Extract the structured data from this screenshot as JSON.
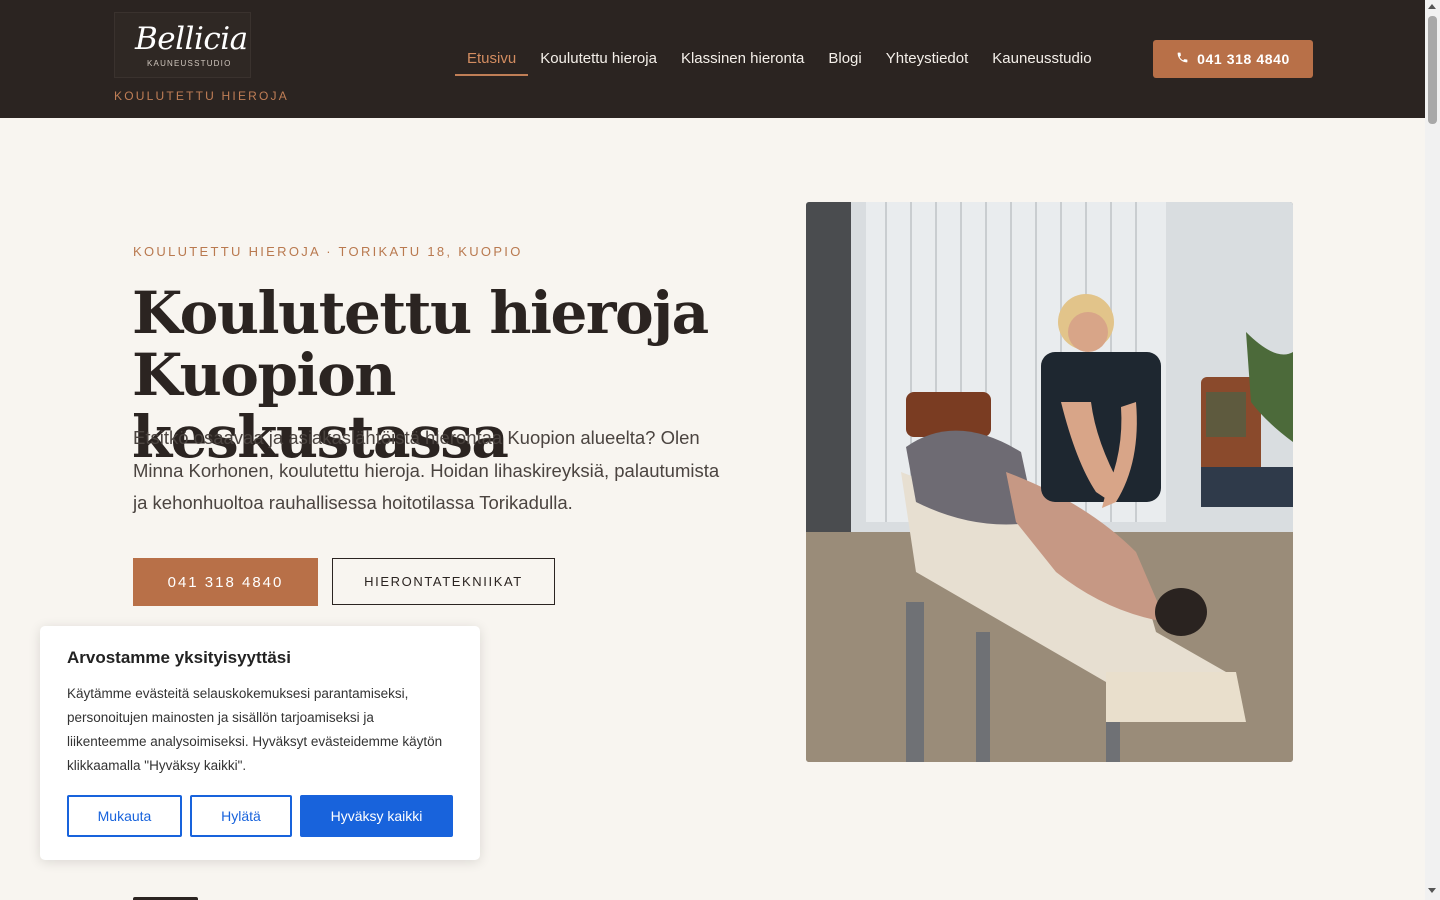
{
  "brand": {
    "logo_script": "Bellicia",
    "logo_sub": "KAUNEUSSTUDIO",
    "tagline": "KOULUTETTU HIEROJA"
  },
  "nav": {
    "items": [
      {
        "label": "Etusivu",
        "active": true
      },
      {
        "label": "Koulutettu hieroja"
      },
      {
        "label": "Klassinen hieronta"
      },
      {
        "label": "Blogi"
      },
      {
        "label": "Yhteystiedot"
      },
      {
        "label": "Kauneusstudio"
      }
    ],
    "phone_button": "041 318 4840",
    "phone_icon": "phone-icon"
  },
  "hero": {
    "eyebrow": "KOULUTETTU HIEROJA · TORIKATU 18, KUOPIO",
    "title_line1": "Koulutettu hieroja",
    "title_line2": "Kuopion keskustassa",
    "text": "Etsitkö osaavaa ja asiakaslähtöistä hierontaa Kuopion alueelta? Olen Minna Korhonen, koulutettu hieroja. Hoidan lihaskireyksiä, palautumista ja kehonhuoltoa rauhallisessa hoitotilassa Torikadulla.",
    "primary_button": "041 318 4840",
    "secondary_button": "HIERONTATEKNIIKAT"
  },
  "cookie": {
    "title": "Arvostamme yksityisyyttäsi",
    "text": "Käytämme evästeitä selauskokemuksesi parantamiseksi, personoitujen mainosten ja sisällön tarjoamiseksi ja liikenteemme analysoimiseksi. Hyväksyt evästeidemme käytön klikkaamalla \"Hyväksy kaikki\".",
    "customize": "Mukauta",
    "reject": "Hylätä",
    "accept": "Hyväksy kaikki"
  },
  "colors": {
    "header_bg": "#2b2421",
    "accent": "#b87048",
    "page_bg": "#f8f5f0",
    "cookie_blue": "#1863dc"
  }
}
